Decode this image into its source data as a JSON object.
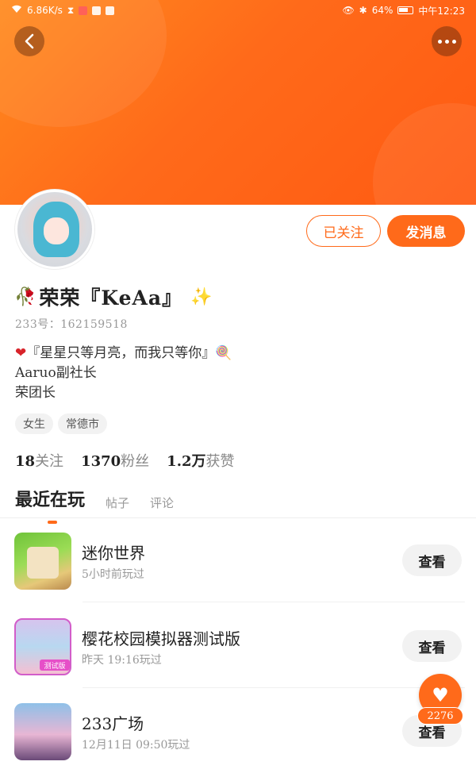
{
  "status_bar": {
    "network_speed": "6.86K/s",
    "battery": "64%",
    "time": "中午12:23"
  },
  "nav": {
    "back_icon": "chevron-left-icon",
    "more_icon": "more-horizontal-icon"
  },
  "profile": {
    "name": "荣荣『KeAa』",
    "uid": "233号：162159518",
    "bio": [
      "『星星只等月亮，而我只等你』",
      "Aaruo副社长",
      "荣团长"
    ],
    "tags": [
      "女生",
      "常德市"
    ],
    "stats": [
      {
        "num": "18",
        "label": "关注"
      },
      {
        "num": "1370",
        "label": "粉丝"
      },
      {
        "num": "1.2万",
        "label": "获赞"
      }
    ]
  },
  "actions": {
    "follow_label": "已关注",
    "message_label": "发消息"
  },
  "tabs": [
    "最近在玩",
    "帖子",
    "评论"
  ],
  "games": [
    {
      "title": "迷你世界",
      "played": "5小时前玩过",
      "button": "查看"
    },
    {
      "title": "樱花校园模拟器测试版",
      "played": "昨天 19:16玩过",
      "button": "查看",
      "badge": "测试版"
    },
    {
      "title": "233广场",
      "played": "12月11日 09:50玩过",
      "button": "查看"
    }
  ],
  "like_fab": {
    "count": "2276"
  },
  "colors": {
    "accent": "#ff6a1a",
    "banner_start": "#ff8a1e",
    "banner_end": "#ff5a12"
  }
}
